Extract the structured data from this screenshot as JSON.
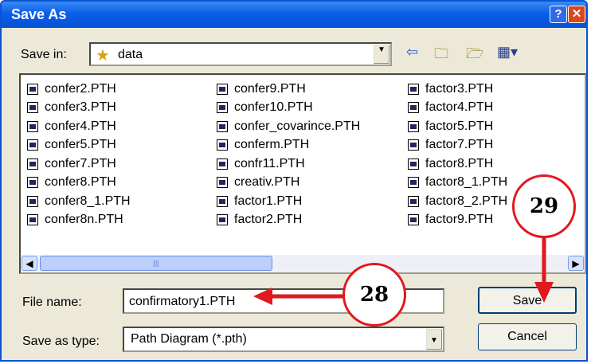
{
  "window": {
    "title": "Save As",
    "help_button": "?",
    "close_button": "✕"
  },
  "toolbar": {
    "save_in_label": "Save in:",
    "save_in_value": "data",
    "icons": [
      "back-arrow-icon",
      "up-folder-icon",
      "new-folder-icon",
      "view-menu-icon"
    ]
  },
  "files": {
    "col1": [
      "confer2.PTH",
      "confer3.PTH",
      "confer4.PTH",
      "confer5.PTH",
      "confer7.PTH",
      "confer8.PTH",
      "confer8_1.PTH",
      "confer8n.PTH"
    ],
    "col2": [
      "confer9.PTH",
      "confer10.PTH",
      "confer_covarince.PTH",
      "conferm.PTH",
      "confr11.PTH",
      "creativ.PTH",
      "factor1.PTH",
      "factor2.PTH"
    ],
    "col3": [
      "factor3.PTH",
      "factor4.PTH",
      "factor5.PTH",
      "factor7.PTH",
      "factor8.PTH",
      "factor8_1.PTH",
      "factor8_2.PTH",
      "factor9.PTH"
    ]
  },
  "form": {
    "file_name_label": "File name:",
    "file_name_value": "confirmatory1.PTH",
    "save_as_type_label": "Save as type:",
    "save_as_type_value": "Path Diagram (*.pth)"
  },
  "buttons": {
    "save": "Save",
    "cancel": "Cancel"
  },
  "annotations": {
    "step_28": "28",
    "step_29": "29",
    "color": "#e1181e"
  }
}
